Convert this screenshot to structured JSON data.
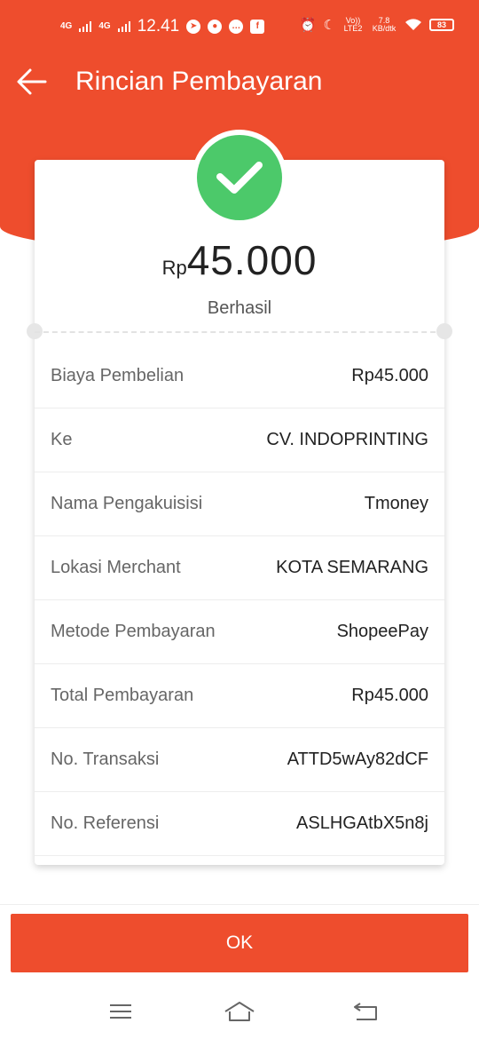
{
  "status_bar": {
    "network1": "4G",
    "network2": "4G",
    "time": "12.41",
    "volte": "Vo)) LTE2",
    "speed": "7.8 KB/dtk",
    "battery": "83"
  },
  "header": {
    "title": "Rincian Pembayaran"
  },
  "summary": {
    "currency": "Rp",
    "amount": "45.000",
    "status": "Berhasil"
  },
  "details": [
    {
      "label": "Biaya Pembelian",
      "value": "Rp45.000"
    },
    {
      "label": "Ke",
      "value": "CV. INDOPRINTING"
    },
    {
      "label": "Nama Pengakuisisi",
      "value": "Tmoney"
    },
    {
      "label": "Lokasi Merchant",
      "value": "KOTA SEMARANG"
    },
    {
      "label": "Metode Pembayaran",
      "value": "ShopeePay"
    },
    {
      "label": "Total Pembayaran",
      "value": "Rp45.000"
    },
    {
      "label": "No. Transaksi",
      "value": "ATTD5wAy82dCF"
    },
    {
      "label": "No. Referensi",
      "value": "ASLHGAtbX5n8j"
    }
  ],
  "footer": {
    "ok_label": "OK"
  },
  "colors": {
    "brand": "#ee4d2d",
    "success": "#4cc96a"
  },
  "icons": {
    "back": "arrow-left-icon",
    "success": "check-icon",
    "nav_menu": "menu-icon",
    "nav_home": "home-icon",
    "nav_back": "back-icon"
  }
}
